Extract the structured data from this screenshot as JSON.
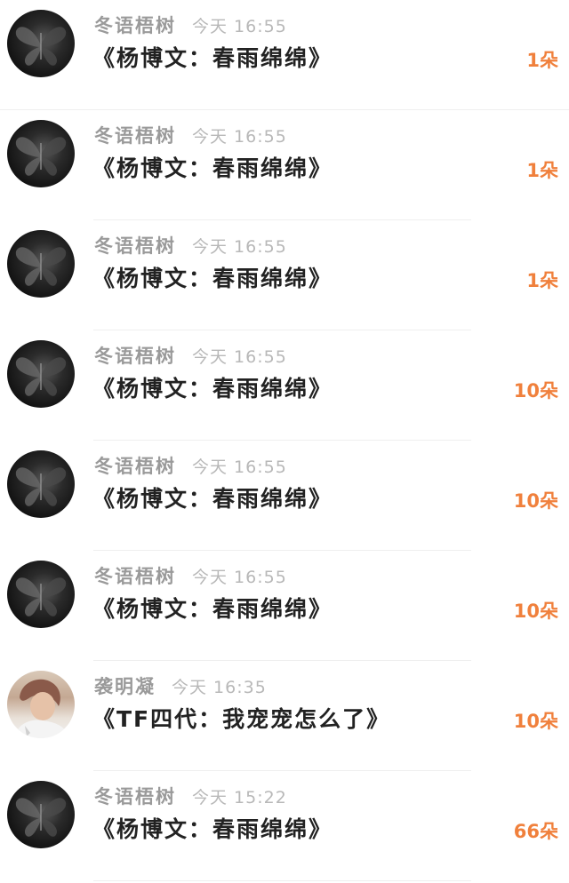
{
  "accent_color": "#f0803c",
  "items": [
    {
      "avatar": "butterfly-avatar",
      "name": "冬语梧树",
      "time": "今天 16:55",
      "title": "《杨博文：春雨绵绵》",
      "count": "1朵"
    },
    {
      "avatar": "butterfly-avatar",
      "name": "冬语梧树",
      "time": "今天 16:55",
      "title": "《杨博文：春雨绵绵》",
      "count": "1朵"
    },
    {
      "avatar": "butterfly-avatar",
      "name": "冬语梧树",
      "time": "今天 16:55",
      "title": "《杨博文：春雨绵绵》",
      "count": "1朵"
    },
    {
      "avatar": "butterfly-avatar",
      "name": "冬语梧树",
      "time": "今天 16:55",
      "title": "《杨博文：春雨绵绵》",
      "count": "10朵"
    },
    {
      "avatar": "butterfly-avatar",
      "name": "冬语梧树",
      "time": "今天 16:55",
      "title": "《杨博文：春雨绵绵》",
      "count": "10朵"
    },
    {
      "avatar": "butterfly-avatar",
      "name": "冬语梧树",
      "time": "今天 16:55",
      "title": "《杨博文：春雨绵绵》",
      "count": "10朵"
    },
    {
      "avatar": "person-photo-avatar",
      "name": "袭明凝",
      "time": "今天 16:35",
      "title": "《TF四代：我宠宠怎么了》",
      "count": "10朵"
    },
    {
      "avatar": "butterfly-avatar",
      "name": "冬语梧树",
      "time": "今天 15:22",
      "title": "《杨博文：春雨绵绵》",
      "count": "66朵"
    }
  ]
}
